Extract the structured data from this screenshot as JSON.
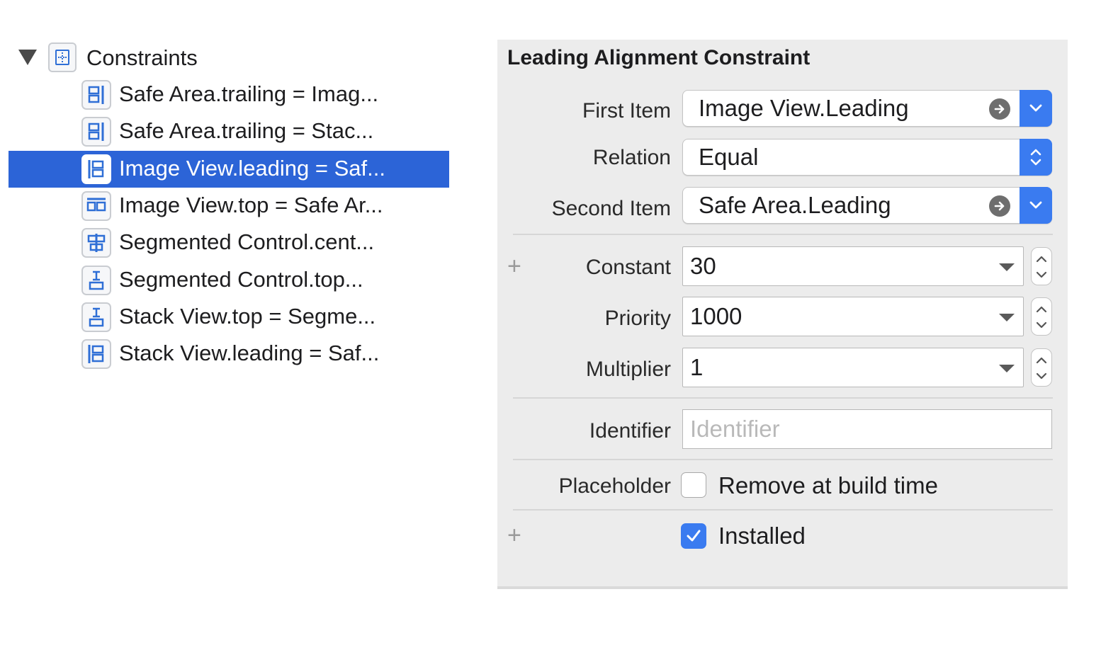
{
  "outline": {
    "group_title": "Constraints",
    "items": [
      {
        "label": "Safe Area.trailing = Imag...",
        "icon": "trailing-constraint-icon"
      },
      {
        "label": "Safe Area.trailing = Stac...",
        "icon": "trailing-constraint-icon"
      },
      {
        "label": "Image View.leading = Saf...",
        "icon": "leading-constraint-icon",
        "selected": true
      },
      {
        "label": "Image View.top = Safe Ar...",
        "icon": "top-alignment-icon"
      },
      {
        "label": "Segmented Control.cent...",
        "icon": "center-x-constraint-icon"
      },
      {
        "label": "Segmented Control.top...",
        "icon": "vertical-spacing-icon"
      },
      {
        "label": "Stack View.top = Segme...",
        "icon": "vertical-spacing-icon"
      },
      {
        "label": "Stack View.leading = Saf...",
        "icon": "leading-constraint-icon"
      }
    ]
  },
  "inspector": {
    "title": "Leading Alignment Constraint",
    "first_item": {
      "label": "First Item",
      "value": "Image View.Leading"
    },
    "relation": {
      "label": "Relation",
      "value": "Equal"
    },
    "second_item": {
      "label": "Second Item",
      "value": "Safe Area.Leading"
    },
    "constant": {
      "label": "Constant",
      "value": "30"
    },
    "priority": {
      "label": "Priority",
      "value": "1000"
    },
    "multiplier": {
      "label": "Multiplier",
      "value": "1"
    },
    "identifier": {
      "label": "Identifier",
      "value": "",
      "placeholder": "Identifier"
    },
    "placeholder": {
      "label": "Placeholder",
      "checkbox_label": "Remove at build time",
      "checked": false
    },
    "installed": {
      "checkbox_label": "Installed",
      "checked": true
    },
    "plus_symbol": "+"
  },
  "colors": {
    "selection": "#2c64d7",
    "accent": "#3a7bf0",
    "panel_bg": "#ececec"
  }
}
